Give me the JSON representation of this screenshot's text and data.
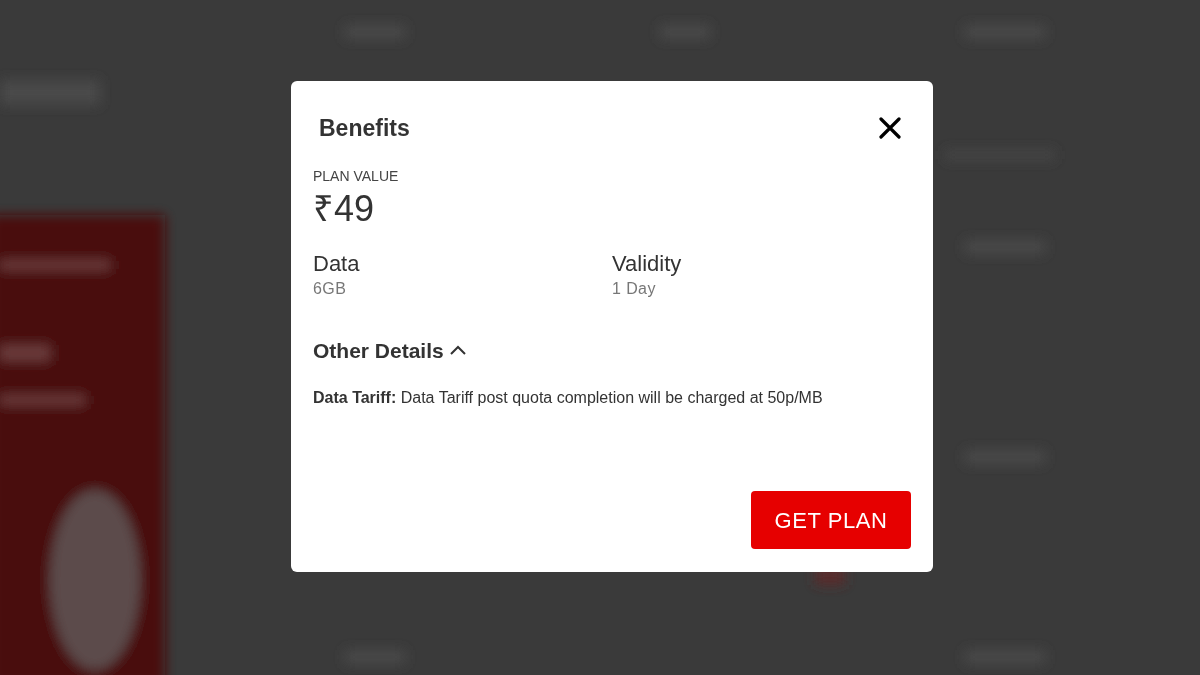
{
  "dialog": {
    "title": "Benefits",
    "plan_value": {
      "label": "PLAN VALUE",
      "value": "₹49"
    },
    "specs": [
      {
        "label": "Data",
        "value": "6GB"
      },
      {
        "label": "Validity",
        "value": "1 Day"
      }
    ],
    "other_details": {
      "label": "Other Details",
      "expanded": true,
      "items": [
        "**Data Tariff:** Data Tariff post quota completion will be charged at 50p/MB"
      ]
    },
    "button": "GET PLAN"
  }
}
